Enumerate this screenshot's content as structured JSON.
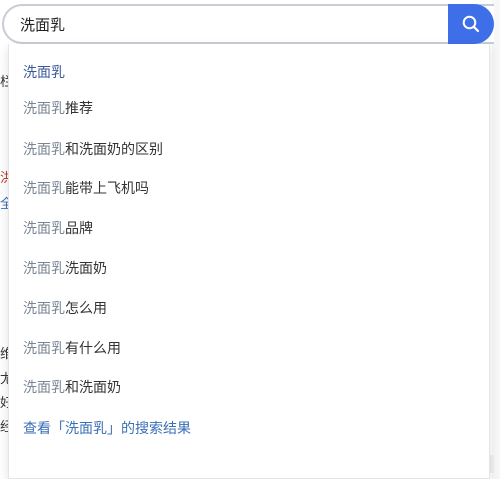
{
  "search": {
    "query": "洗面乳",
    "button_icon": "search-icon",
    "accent_color": "#3f6fe8"
  },
  "suggestions": [
    {
      "highlight": "洗面乳",
      "suffix": ""
    },
    {
      "highlight": "洗面乳",
      "suffix": "推荐"
    },
    {
      "highlight": "洗面乳",
      "suffix": "和洗面奶的区别"
    },
    {
      "highlight": "洗面乳",
      "suffix": "能带上飞机吗"
    },
    {
      "highlight": "洗面乳",
      "suffix": "品牌"
    },
    {
      "highlight": "洗面乳",
      "suffix": "洗面奶"
    },
    {
      "highlight": "洗面乳",
      "suffix": "怎么用"
    },
    {
      "highlight": "洗面乳",
      "suffix": "有什么用"
    },
    {
      "highlight": "洗面乳",
      "suffix": "和洗面奶"
    }
  ],
  "view_all": "查看「洗面乳」的搜索结果",
  "background_fragments": [
    "栏",
    "洪",
    "全",
    "维",
    "尤",
    "好",
    "经"
  ]
}
